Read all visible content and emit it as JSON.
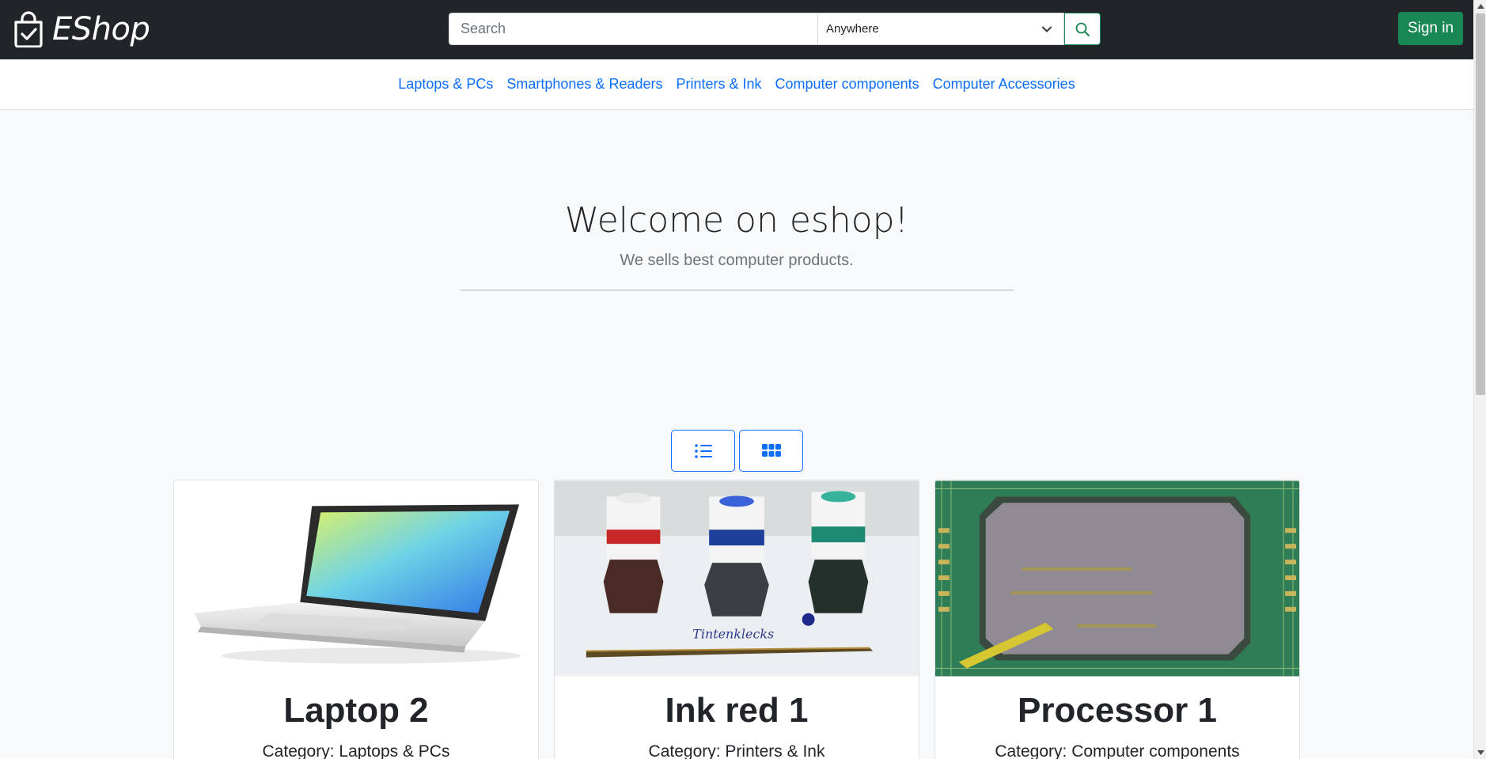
{
  "navbar": {
    "brand": "EShop",
    "search": {
      "placeholder": "Search",
      "value": ""
    },
    "scope_select": {
      "selected": "Anywhere"
    },
    "signin_label": "Sign in"
  },
  "categories": [
    "Laptops & PCs",
    "Smartphones & Readers",
    "Printers & Ink",
    "Computer components",
    "Computer Accessories"
  ],
  "hero": {
    "title": "Welcome on eshop!",
    "subtitle": "We sells best computer products."
  },
  "view_toggle": {
    "list_icon": "list-icon",
    "grid_icon": "grid-icon"
  },
  "products": [
    {
      "title": "Laptop 2",
      "category": "Category: Laptops & PCs",
      "image": "laptop-image"
    },
    {
      "title": "Ink red 1",
      "category": "Category: Printers & Ink",
      "image": "ink-bottles-image",
      "image_caption": "Tintenklecks"
    },
    {
      "title": "Processor 1",
      "category": "Category: Computer components",
      "image": "processor-chip-image"
    }
  ],
  "colors": {
    "navbar_bg": "#212529",
    "link": "#0d6efd",
    "success": "#198754",
    "page_bg": "#f8f9fa"
  }
}
